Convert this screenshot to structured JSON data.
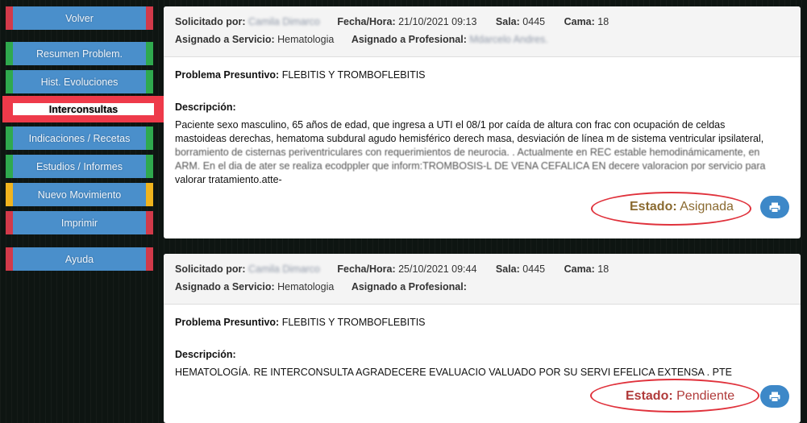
{
  "sidebar": {
    "items": [
      {
        "label": "Volver"
      },
      {
        "label": "Resumen Problem."
      },
      {
        "label": "Hist. Evoluciones"
      },
      {
        "label": "Interconsultas"
      },
      {
        "label": "Indicaciones / Recetas"
      },
      {
        "label": "Estudios / Informes"
      },
      {
        "label": "Nuevo Movimiento"
      },
      {
        "label": "Imprimir"
      },
      {
        "label": "Ayuda"
      }
    ]
  },
  "labels": {
    "solicitado": "Solicitado por:",
    "fecha": "Fecha/Hora:",
    "sala": "Sala:",
    "cama": "Cama:",
    "servicio": "Asignado a Servicio:",
    "profesional": "Asignado a Profesional:",
    "problema": "Problema Presuntivo:",
    "descripcion": "Descripción:",
    "estado": "Estado:"
  },
  "cards": [
    {
      "solicitado_por": "Camila Dimarco",
      "fecha_hora": "21/10/2021 09:13",
      "sala": "0445",
      "cama": "18",
      "servicio": "Hematologia",
      "profesional": "Mdarcelo Andres.",
      "problema": "FLEBITIS Y TROMBOFLEBITIS",
      "descripcion_lines": [
        "Paciente sexo masculino, 65 años de edad, que ingresa a UTI el 08/1 por caída de altura con frac con ocupación de celdas",
        "mastoideas derechas, hematoma subdural agudo hemisférico derech masa, desviación de línea m de sistema ventricular ipsilateral,",
        "borramiento de cisternas periventriculares con requerimientos de neurocia. . Actualmente en REC estable hemodinámicamente, en",
        "ARM. En el dia de ater se realiza ecodppler que inform:TROMBOSIS-L DE VENA CEFALICA EN decere valoracion por servicio para",
        "valorar tratamiento.atte-"
      ],
      "estado": "Asignada"
    },
    {
      "solicitado_por": "Camila Dimarco",
      "fecha_hora": "25/10/2021 09:44",
      "sala": "0445",
      "cama": "18",
      "servicio": "Hematologia",
      "profesional": "",
      "problema": "FLEBITIS Y TROMBOFLEBITIS",
      "descripcion_lines": [
        "HEMATOLOGÍA. RE INTERCONSULTA AGRADECERE EVALUACIO VALUADO POR SU SERVI EFELICA EXTENSA . PTE"
      ],
      "estado": "Pendiente"
    }
  ],
  "colors": {
    "asignada": "#8a6a30",
    "pendiente": "#b03a3a",
    "highlight": "#e0323c",
    "button_blue": "#4a8fcb"
  },
  "icons": {
    "print": "printer-icon"
  }
}
